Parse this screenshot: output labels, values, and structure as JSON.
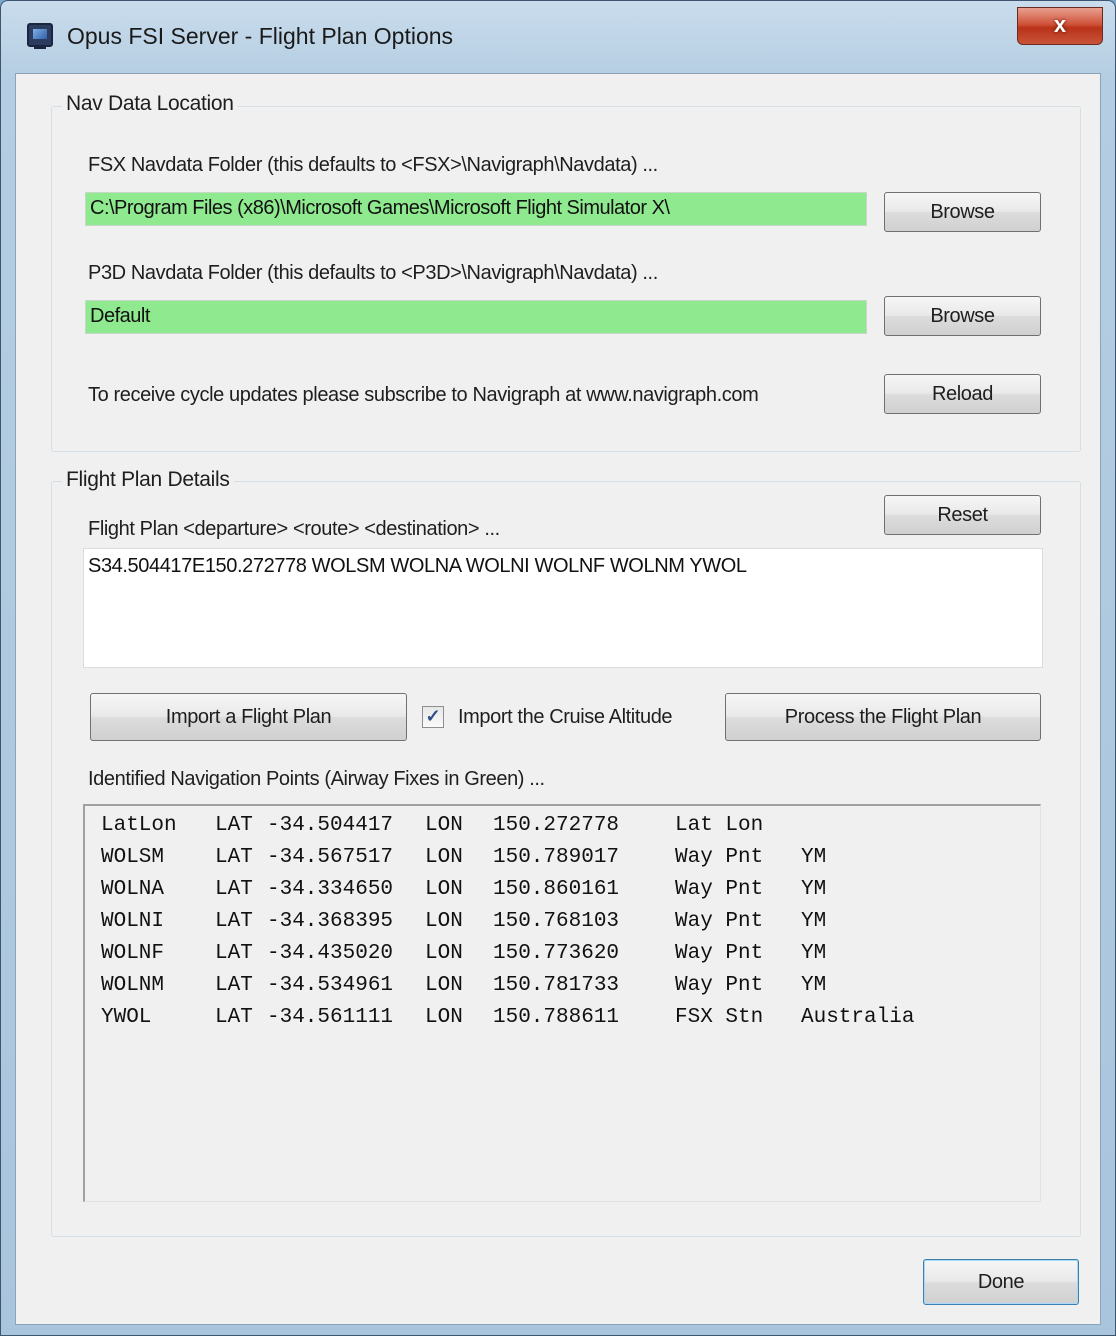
{
  "window": {
    "title": "Opus FSI Server - Flight Plan Options",
    "close_glyph": "x"
  },
  "nav_data": {
    "group_label": "Nav Data Location",
    "fsx_label": "FSX Navdata Folder (this defaults to <FSX>\\Navigraph\\Navdata) ...",
    "fsx_path": "C:\\Program Files (x86)\\Microsoft Games\\Microsoft Flight Simulator X\\",
    "fsx_browse": "Browse",
    "p3d_label": "P3D Navdata Folder (this defaults to <P3D>\\Navigraph\\Navdata) ...",
    "p3d_path": "Default",
    "p3d_browse": "Browse",
    "subscribe_text": "To receive cycle updates please subscribe to Navigraph at www.navigraph.com",
    "reload": "Reload",
    "field_color": "#8fe98f"
  },
  "flight_plan": {
    "group_label": "Flight Plan Details",
    "plan_label": "Flight Plan <departure> <route> <destination> ...",
    "reset": "Reset",
    "plan_text": "S34.504417E150.272778 WOLSM WOLNA WOLNI WOLNF WOLNM YWOL",
    "import_button": "Import a Flight Plan",
    "cruise_checkbox_label": "Import the Cruise Altitude",
    "cruise_checked": true,
    "process_button": "Process the Flight Plan",
    "points_label": "Identified Navigation Points (Airway Fixes in Green) ...",
    "points": [
      {
        "id": "LatLon",
        "lat_tag": "LAT",
        "lat": "-34.504417",
        "lon_tag": "LON",
        "lon": "150.272778",
        "type": "Lat Lon",
        "region": ""
      },
      {
        "id": "WOLSM",
        "lat_tag": "LAT",
        "lat": "-34.567517",
        "lon_tag": "LON",
        "lon": "150.789017",
        "type": "Way Pnt",
        "region": "YM"
      },
      {
        "id": "WOLNA",
        "lat_tag": "LAT",
        "lat": "-34.334650",
        "lon_tag": "LON",
        "lon": "150.860161",
        "type": "Way Pnt",
        "region": "YM"
      },
      {
        "id": "WOLNI",
        "lat_tag": "LAT",
        "lat": "-34.368395",
        "lon_tag": "LON",
        "lon": "150.768103",
        "type": "Way Pnt",
        "region": "YM"
      },
      {
        "id": "WOLNF",
        "lat_tag": "LAT",
        "lat": "-34.435020",
        "lon_tag": "LON",
        "lon": "150.773620",
        "type": "Way Pnt",
        "region": "YM"
      },
      {
        "id": "WOLNM",
        "lat_tag": "LAT",
        "lat": "-34.534961",
        "lon_tag": "LON",
        "lon": "150.781733",
        "type": "Way Pnt",
        "region": "YM"
      },
      {
        "id": "YWOL",
        "lat_tag": "LAT",
        "lat": "-34.561111",
        "lon_tag": "LON",
        "lon": "150.788611",
        "type": "FSX Stn",
        "region": "Australia"
      }
    ]
  },
  "footer": {
    "done": "Done"
  }
}
